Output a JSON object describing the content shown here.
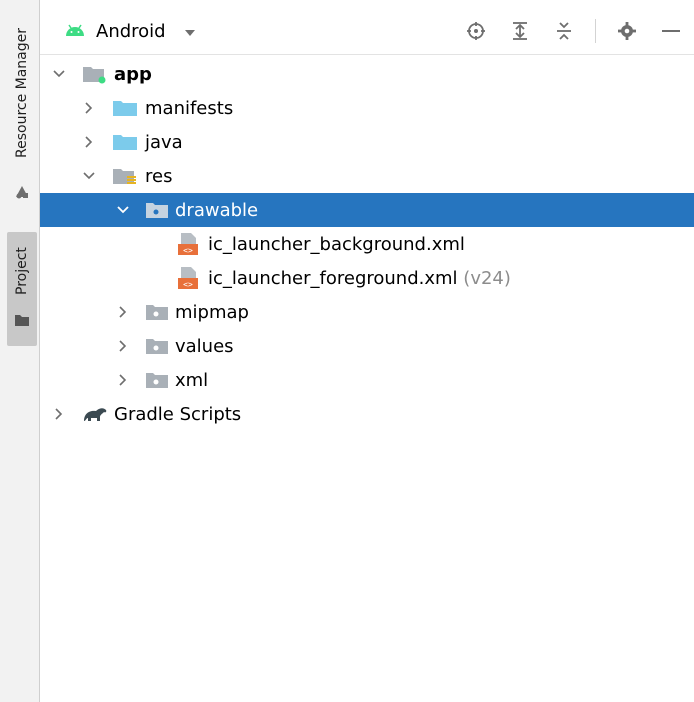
{
  "sidebar": {
    "tabs": [
      {
        "label": "Resource Manager"
      },
      {
        "label": "Project"
      }
    ]
  },
  "header": {
    "view": "Android"
  },
  "tree": {
    "app": "app",
    "manifests": "manifests",
    "java": "java",
    "res": "res",
    "drawable": "drawable",
    "file1": "ic_launcher_background.xml",
    "file2": "ic_launcher_foreground.xml",
    "file2_qualifier": "(v24)",
    "mipmap": "mipmap",
    "values": "values",
    "xml": "xml",
    "gradle": "Gradle Scripts"
  },
  "colors": {
    "selection": "#2675bf",
    "android_green": "#3ddc84",
    "folder_blue": "#7ccbeb",
    "folder_gray": "#a9b0b7",
    "xml_orange": "#e8703a"
  }
}
